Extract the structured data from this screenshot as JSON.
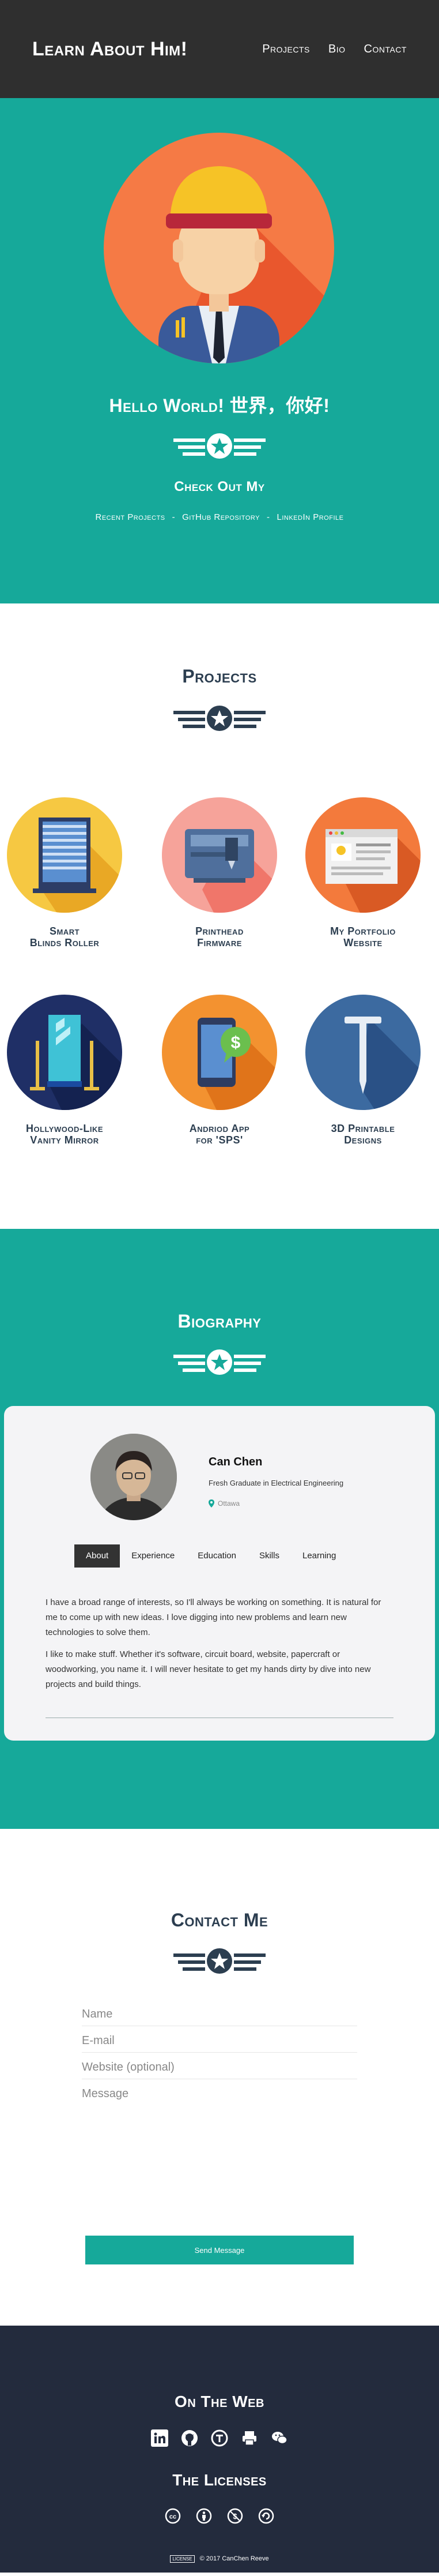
{
  "nav": {
    "brand": "Learn About Him!",
    "links": [
      "Projects",
      "Bio",
      "Contact"
    ]
  },
  "hero": {
    "title": "Hello World!  世界，你好!",
    "subtitle": "Check Out My",
    "links": [
      "Recent Projects",
      "GitHub Repository",
      "LinkedIn Profile"
    ],
    "separator": "-"
  },
  "projects": {
    "title": "Projects",
    "items": [
      {
        "label": "Smart\nBlinds Roller",
        "icon": "blinds-icon",
        "color": "#f6c842"
      },
      {
        "label": "Printhead\nFirmware",
        "icon": "printhead-icon",
        "color": "#f4857a"
      },
      {
        "label": "My Portfolio\nWebsite",
        "icon": "browser-window-icon",
        "color": "#f37a3c"
      },
      {
        "label": "Hollywood-Like\nVanity Mirror",
        "icon": "mirror-icon",
        "color": "#1f2f66"
      },
      {
        "label": "Andriod App\nfor 'SPS'",
        "icon": "android-app-icon",
        "color": "#f39230"
      },
      {
        "label": "3D Printable\nDesigns",
        "icon": "nail-icon",
        "color": "#3c6aa0"
      }
    ]
  },
  "bio": {
    "title": "Biography",
    "name": "Can Chen",
    "role": "Fresh Graduate in Electrical Engineering",
    "location": "Ottawa",
    "tabs": [
      "About",
      "Experience",
      "Education",
      "Skills",
      "Learning"
    ],
    "active_tab": "About",
    "paragraphs": [
      "I have a broad range of interests, so I'll always be working on something. It is natural for me to come up with new ideas. I love digging into new problems and learn new technologies to solve them.",
      "I like to make stuff. Whether it's software, circuit board, website, papercraft or woodworking, you name it. I will never hesitate to get my hands dirty by dive into new projects and build things."
    ]
  },
  "contact": {
    "title": "Contact Me",
    "placeholders": [
      "Name",
      "E-mail",
      "Website (optional)",
      "Message"
    ],
    "send_label": "Send Message"
  },
  "footer": {
    "web_title": "On The Web",
    "social_icons": [
      "linkedin-icon",
      "github-icon",
      "tumblr-icon",
      "printer-icon",
      "wechat-icon"
    ],
    "licenses_title": "The Licenses",
    "license_icons": [
      "cc-icon",
      "by-icon",
      "nc-icon",
      "sa-icon"
    ],
    "badge": "LICENSE",
    "copyright": "© 2017 CanChen Reeve"
  },
  "colors": {
    "teal": "#16a99a",
    "nav": "#2f2f2f",
    "footer": "#232b3d",
    "heading": "#2c3e50"
  }
}
